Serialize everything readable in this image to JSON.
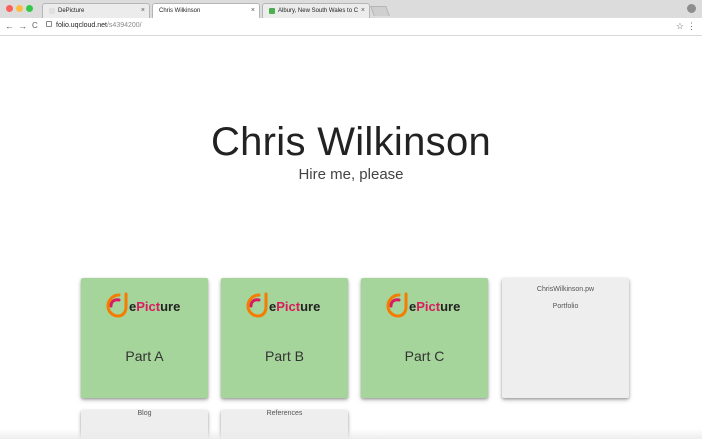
{
  "browser": {
    "tabs": [
      {
        "title": "DePicture",
        "favicon_color": "#e0e0e0",
        "active": false
      },
      {
        "title": "Chris Wilkinson",
        "favicon_color": "#e0e0e0",
        "active": true
      },
      {
        "title": "Albury, New South Wales to Ca",
        "favicon_color": "#4caf50",
        "active": false
      }
    ],
    "close_glyph": "×",
    "url_host": "folio.uqcloud.net",
    "url_path": "/s4394200/",
    "back_glyph": "←",
    "forward_glyph": "→",
    "reload_glyph": "C",
    "star_glyph": "☆",
    "menu_glyph": "⋮"
  },
  "hero": {
    "name": "Chris Wilkinson",
    "tagline": "Hire me, please"
  },
  "cards": {
    "part_a": {
      "logo_text_e": "e",
      "logo_text_pict": "Pict",
      "logo_text_ure": "ure",
      "label": "Part A"
    },
    "part_b": {
      "logo_text_e": "e",
      "logo_text_pict": "Pict",
      "logo_text_ure": "ure",
      "label": "Part B"
    },
    "part_c": {
      "logo_text_e": "e",
      "logo_text_pict": "Pict",
      "logo_text_ure": "ure",
      "label": "Part C"
    },
    "portfolio": {
      "title": "ChrisWilkinson.pw",
      "subtitle": "Portfolio"
    },
    "blog": {
      "title": "Blog"
    },
    "references": {
      "title": "References"
    }
  },
  "colors": {
    "card_green": "#a5d59b",
    "card_grey": "#eeeeee",
    "logo_magenta": "#d81b60",
    "logo_orange": "#f57c00",
    "logo_dark": "#222222"
  }
}
